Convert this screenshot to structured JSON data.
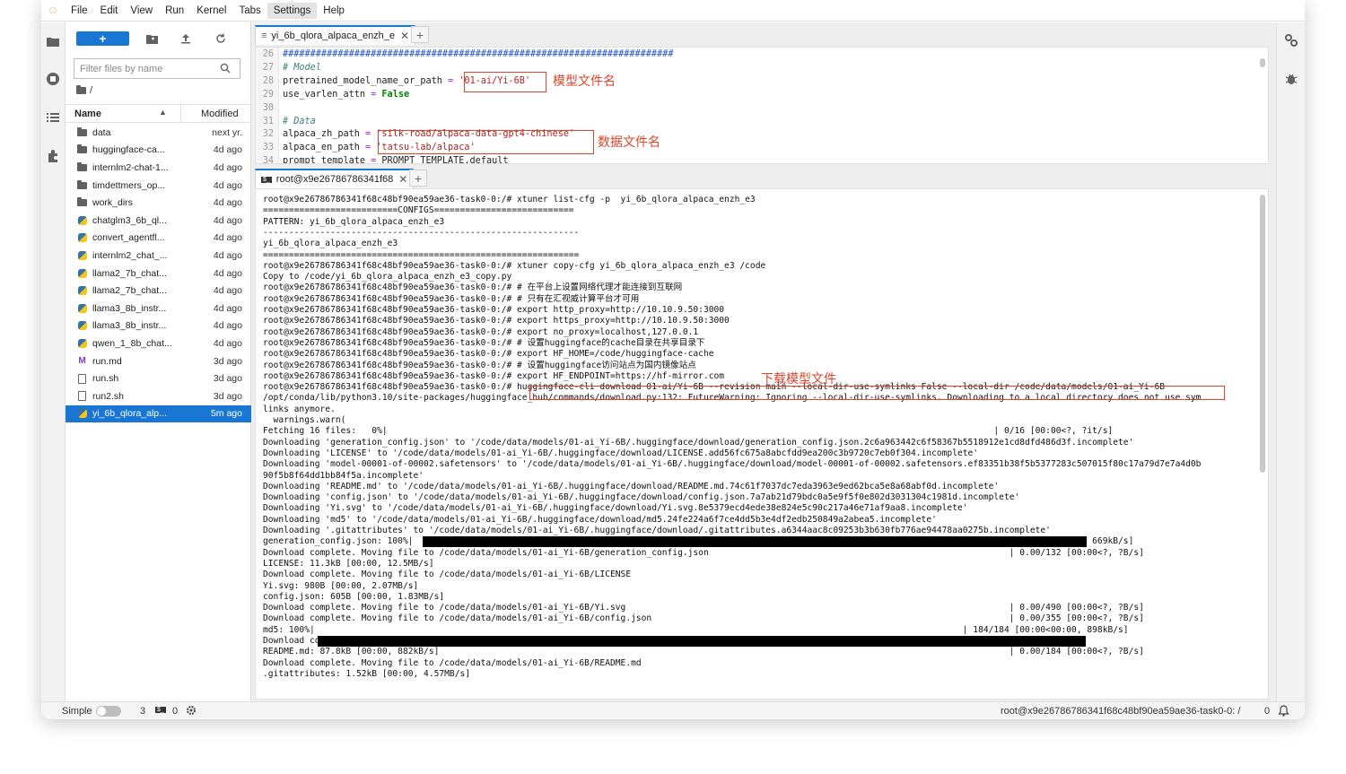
{
  "menu": [
    "File",
    "Edit",
    "View",
    "Run",
    "Kernel",
    "Tabs",
    "Settings",
    "Help"
  ],
  "filebrowser": {
    "new_label": "+",
    "filter_placeholder": "Filter files by name",
    "breadcrumb": "/",
    "col_name": "Name",
    "col_modified": "Modified",
    "files": [
      {
        "name": "data",
        "modified": "next yr.",
        "type": "folder"
      },
      {
        "name": "huggingface-ca...",
        "modified": "4d ago",
        "type": "folder"
      },
      {
        "name": "internlm2-chat-1...",
        "modified": "4d ago",
        "type": "folder"
      },
      {
        "name": "timdettmers_op...",
        "modified": "4d ago",
        "type": "folder"
      },
      {
        "name": "work_dirs",
        "modified": "4d ago",
        "type": "folder"
      },
      {
        "name": "chatglm3_6b_ql...",
        "modified": "4d ago",
        "type": "py"
      },
      {
        "name": "convert_agentfl...",
        "modified": "4d ago",
        "type": "py"
      },
      {
        "name": "internlm2_chat_...",
        "modified": "4d ago",
        "type": "py"
      },
      {
        "name": "llama2_7b_chat...",
        "modified": "4d ago",
        "type": "py"
      },
      {
        "name": "llama2_7b_chat...",
        "modified": "4d ago",
        "type": "py"
      },
      {
        "name": "llama3_8b_instr...",
        "modified": "4d ago",
        "type": "py"
      },
      {
        "name": "llama3_8b_instr...",
        "modified": "4d ago",
        "type": "py"
      },
      {
        "name": "qwen_1_8b_chat...",
        "modified": "4d ago",
        "type": "py"
      },
      {
        "name": "run.md",
        "modified": "3d ago",
        "type": "md"
      },
      {
        "name": "run.sh",
        "modified": "3d ago",
        "type": "doc"
      },
      {
        "name": "run2.sh",
        "modified": "3d ago",
        "type": "doc"
      },
      {
        "name": "yi_6b_qlora_alp...",
        "modified": "5m ago",
        "type": "py",
        "selected": true
      }
    ]
  },
  "editor": {
    "tab_label": "yi_6b_qlora_alpaca_enzh_e",
    "lines": [
      {
        "n": "26",
        "parts": [
          [
            "hash",
            "#######################################################################"
          ]
        ]
      },
      {
        "n": "27",
        "parts": [
          [
            "cm",
            "# Model"
          ]
        ]
      },
      {
        "n": "28",
        "parts": [
          [
            "",
            "pretrained_model_name_or_path "
          ],
          [
            "op",
            "="
          ],
          [
            "",
            " "
          ],
          [
            "str",
            "'01-ai/Yi-6B'"
          ]
        ]
      },
      {
        "n": "29",
        "parts": [
          [
            "",
            "use_varlen_attn "
          ],
          [
            "op",
            "="
          ],
          [
            "",
            " "
          ],
          [
            "kw",
            "False"
          ]
        ]
      },
      {
        "n": "30",
        "parts": []
      },
      {
        "n": "31",
        "parts": [
          [
            "cm",
            "# Data"
          ]
        ]
      },
      {
        "n": "32",
        "parts": [
          [
            "",
            "alpaca_zh_path "
          ],
          [
            "op",
            "="
          ],
          [
            "",
            " "
          ],
          [
            "str",
            "'silk-road/alpaca-data-gpt4-chinese'"
          ]
        ]
      },
      {
        "n": "33",
        "parts": [
          [
            "",
            "alpaca_en_path "
          ],
          [
            "op",
            "="
          ],
          [
            "",
            " "
          ],
          [
            "str",
            "'tatsu-lab/alpaca'"
          ]
        ]
      },
      {
        "n": "34",
        "parts": [
          [
            "",
            "prompt_template "
          ],
          [
            "op",
            "="
          ],
          [
            "",
            " PROMPT_TEMPLATE.default"
          ]
        ]
      }
    ],
    "annotation_model": "模型文件名",
    "annotation_data": "数据文件名"
  },
  "terminal": {
    "tab_label": "root@x9e26786786341f68",
    "annotation_download": "下载模型文件",
    "lines": [
      "root@x9e26786786341f68c48bf90ea59ae36-task0-0:/# xtuner list-cfg -p  yi_6b_qlora_alpaca_enzh_e3",
      "==========================CONFIGS===========================",
      "PATTERN: yi_6b_qlora_alpaca_enzh_e3",
      "-------------------------------------------------------------",
      "yi_6b_qlora_alpaca_enzh_e3",
      "=============================================================",
      "root@x9e26786786341f68c48bf90ea59ae36-task0-0:/# xtuner copy-cfg yi_6b_qlora_alpaca_enzh_e3 /code",
      "Copy to /code/yi_6b_qlora_alpaca_enzh_e3_copy.py",
      "root@x9e26786786341f68c48bf90ea59ae36-task0-0:/# # 在平台上设置网络代理才能连接到互联网",
      "root@x9e26786786341f68c48bf90ea59ae36-task0-0:/# # 只有在汇视威计算平台才可用",
      "root@x9e26786786341f68c48bf90ea59ae36-task0-0:/# export http_proxy=http://10.10.9.50:3000",
      "root@x9e26786786341f68c48bf90ea59ae36-task0-0:/# export https_proxy=http://10.10.9.50:3000",
      "root@x9e26786786341f68c48bf90ea59ae36-task0-0:/# export no_proxy=localhost,127.0.0.1",
      "root@x9e26786786341f68c48bf90ea59ae36-task0-0:/# # 设置huggingface的cache目录在共享目录下",
      "root@x9e26786786341f68c48bf90ea59ae36-task0-0:/# export HF_HOME=/code/huggingface-cache",
      "root@x9e26786786341f68c48bf90ea59ae36-task0-0:/# # 设置huggingface访问站点为国内镜像站点",
      "root@x9e26786786341f68c48bf90ea59ae36-task0-0:/# export HF_ENDPOINT=https://hf-mirror.com",
      "root@x9e26786786341f68c48bf90ea59ae36-task0-0:/# huggingface-cli download 01-ai/Yi-6B --revision main --local-dir-use-symlinks False --local-dir /code/data/models/01-ai_Yi-6B",
      "/opt/conda/lib/python3.10/site-packages/huggingface_hub/commands/download.py:132: FutureWarning: Ignoring --local-dir-use-symlinks. Downloading to a local directory does not use sym",
      "links anymore.",
      "  warnings.warn(",
      "Fetching 16 files:   0%|                                                                                                                     | 0/16 [00:00<?, ?it/s]",
      "Downloading 'generation_config.json' to '/code/data/models/01-ai_Yi-6B/.huggingface/download/generation_config.json.2c6a963442c6f58367b5518912e1cd8dfd486d3f.incomplete'",
      "Downloading 'LICENSE' to '/code/data/models/01-ai_Yi-6B/.huggingface/download/LICENSE.add56fc675a8abcfdd9ea200c3b9720c7eb0f304.incomplete'",
      "Downloading 'model-00001-of-00002.safetensors' to '/code/data/models/01-ai_Yi-6B/.huggingface/download/model-00001-of-00002.safetensors.ef83351b38f5b5377283c507015f80c17a79d7e7a4d0b",
      "90f5b8f64dd1bb84f5a.incomplete'",
      "Downloading 'README.md' to '/code/data/models/01-ai_Yi-6B/.huggingface/download/README.md.74c61f7037dc7eda3963e9ed62bca5e8a68abf0d.incomplete'",
      "Downloading 'config.json' to '/code/data/models/01-ai_Yi-6B/.huggingface/download/config.json.7a7ab21d79bdc0a5e9f5f0e802d3031304c1981d.incomplete'",
      "Downloading 'Yi.svg' to '/code/data/models/01-ai_Yi-6B/.huggingface/download/Yi.svg.8e5379ecd4ede38e824e5c90c217a46e71af9aa8.incomplete'",
      "Downloading 'md5' to '/code/data/models/01-ai_Yi-6B/.huggingface/download/md5.24fe224a6f7ce4dd5b3e4df2edb250849a2abea5.incomplete'",
      "Downloading '.gitattributes' to '/code/data/models/01-ai_Yi-6B/.huggingface/download/.gitattributes.a6344aac8c09253b3b630fb776ae94478aa0275b.incomplete'",
      "generation_config.json: 100%|                                                                                                           | 132/132 [00:00<00:00, 669kB/s]",
      "Download complete. Moving file to /code/data/models/01-ai_Yi-6B/generation_config.json                                                          | 0.00/132 [00:00<?, ?B/s]",
      "LICENSE: 11.3kB [00:00, 12.5MB/s]",
      "Download complete. Moving file to /code/data/models/01-ai_Yi-6B/LICENSE",
      "Yi.svg: 980B [00:00, 2.07MB/s]",
      "config.json: 605B [00:00, 1.83MB/s]",
      "Download complete. Moving file to /code/data/models/01-ai_Yi-6B/Yi.svg                                                                          | 0.00/490 [00:00<?, ?B/s]",
      "Download complete. Moving file to /code/data/models/01-ai_Yi-6B/config.json                                                                     | 0.00/355 [00:00<?, ?B/s]",
      "md5: 100%|                                                                                                                             | 184/184 [00:00<00:00, 898kB/s]",
      "Download complete. Moving file to /code/data/models/01-ai_Yi-6B/md5",
      "README.md: 87.8kB [00:00, 882kB/s]                                                                                                              | 0.00/184 [00:00<?, ?B/s]",
      "Download complete. Moving file to /code/data/models/01-ai_Yi-6B/README.md",
      ".gitattributes: 1.52kB [00:00, 4.57MB/s]"
    ]
  },
  "status": {
    "mode_label": "Simple",
    "kernels": "3",
    "terminals": "0",
    "right_text": "root@x9e26786786341f68c48bf90ea59ae36-task0-0: /",
    "notifications": "0"
  }
}
